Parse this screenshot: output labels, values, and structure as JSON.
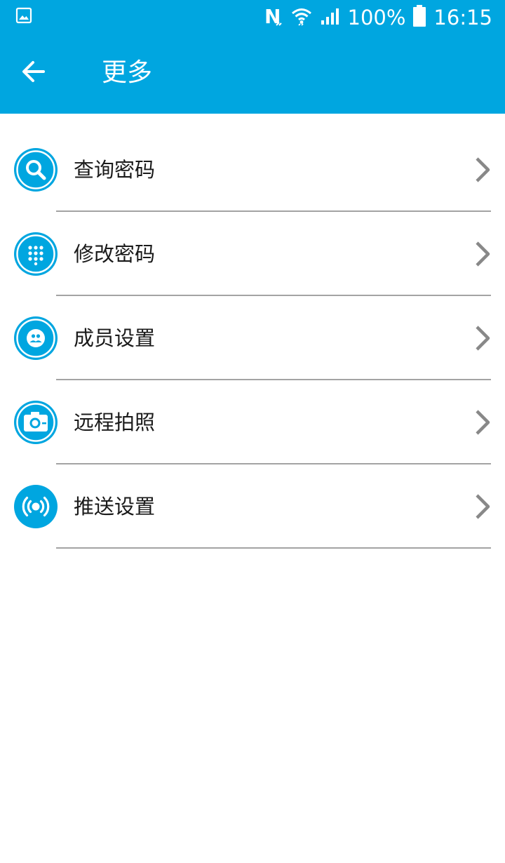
{
  "status_bar": {
    "battery_text": "100%",
    "time": "16:15",
    "icons": [
      "gallery-icon",
      "nfc-icon",
      "wifi-icon",
      "signal-icon",
      "battery-icon"
    ]
  },
  "app_bar": {
    "title": "更多",
    "back_icon": "arrow-left-icon"
  },
  "menu": {
    "items": [
      {
        "label": "查询密码",
        "icon": "search-icon"
      },
      {
        "label": "修改密码",
        "icon": "keypad-icon"
      },
      {
        "label": "成员设置",
        "icon": "members-icon"
      },
      {
        "label": "远程拍照",
        "icon": "camera-icon"
      },
      {
        "label": "推送设置",
        "icon": "broadcast-icon"
      }
    ]
  },
  "colors": {
    "primary": "#00a6e0",
    "divider": "#a3a3a3",
    "chevron": "#888888"
  }
}
